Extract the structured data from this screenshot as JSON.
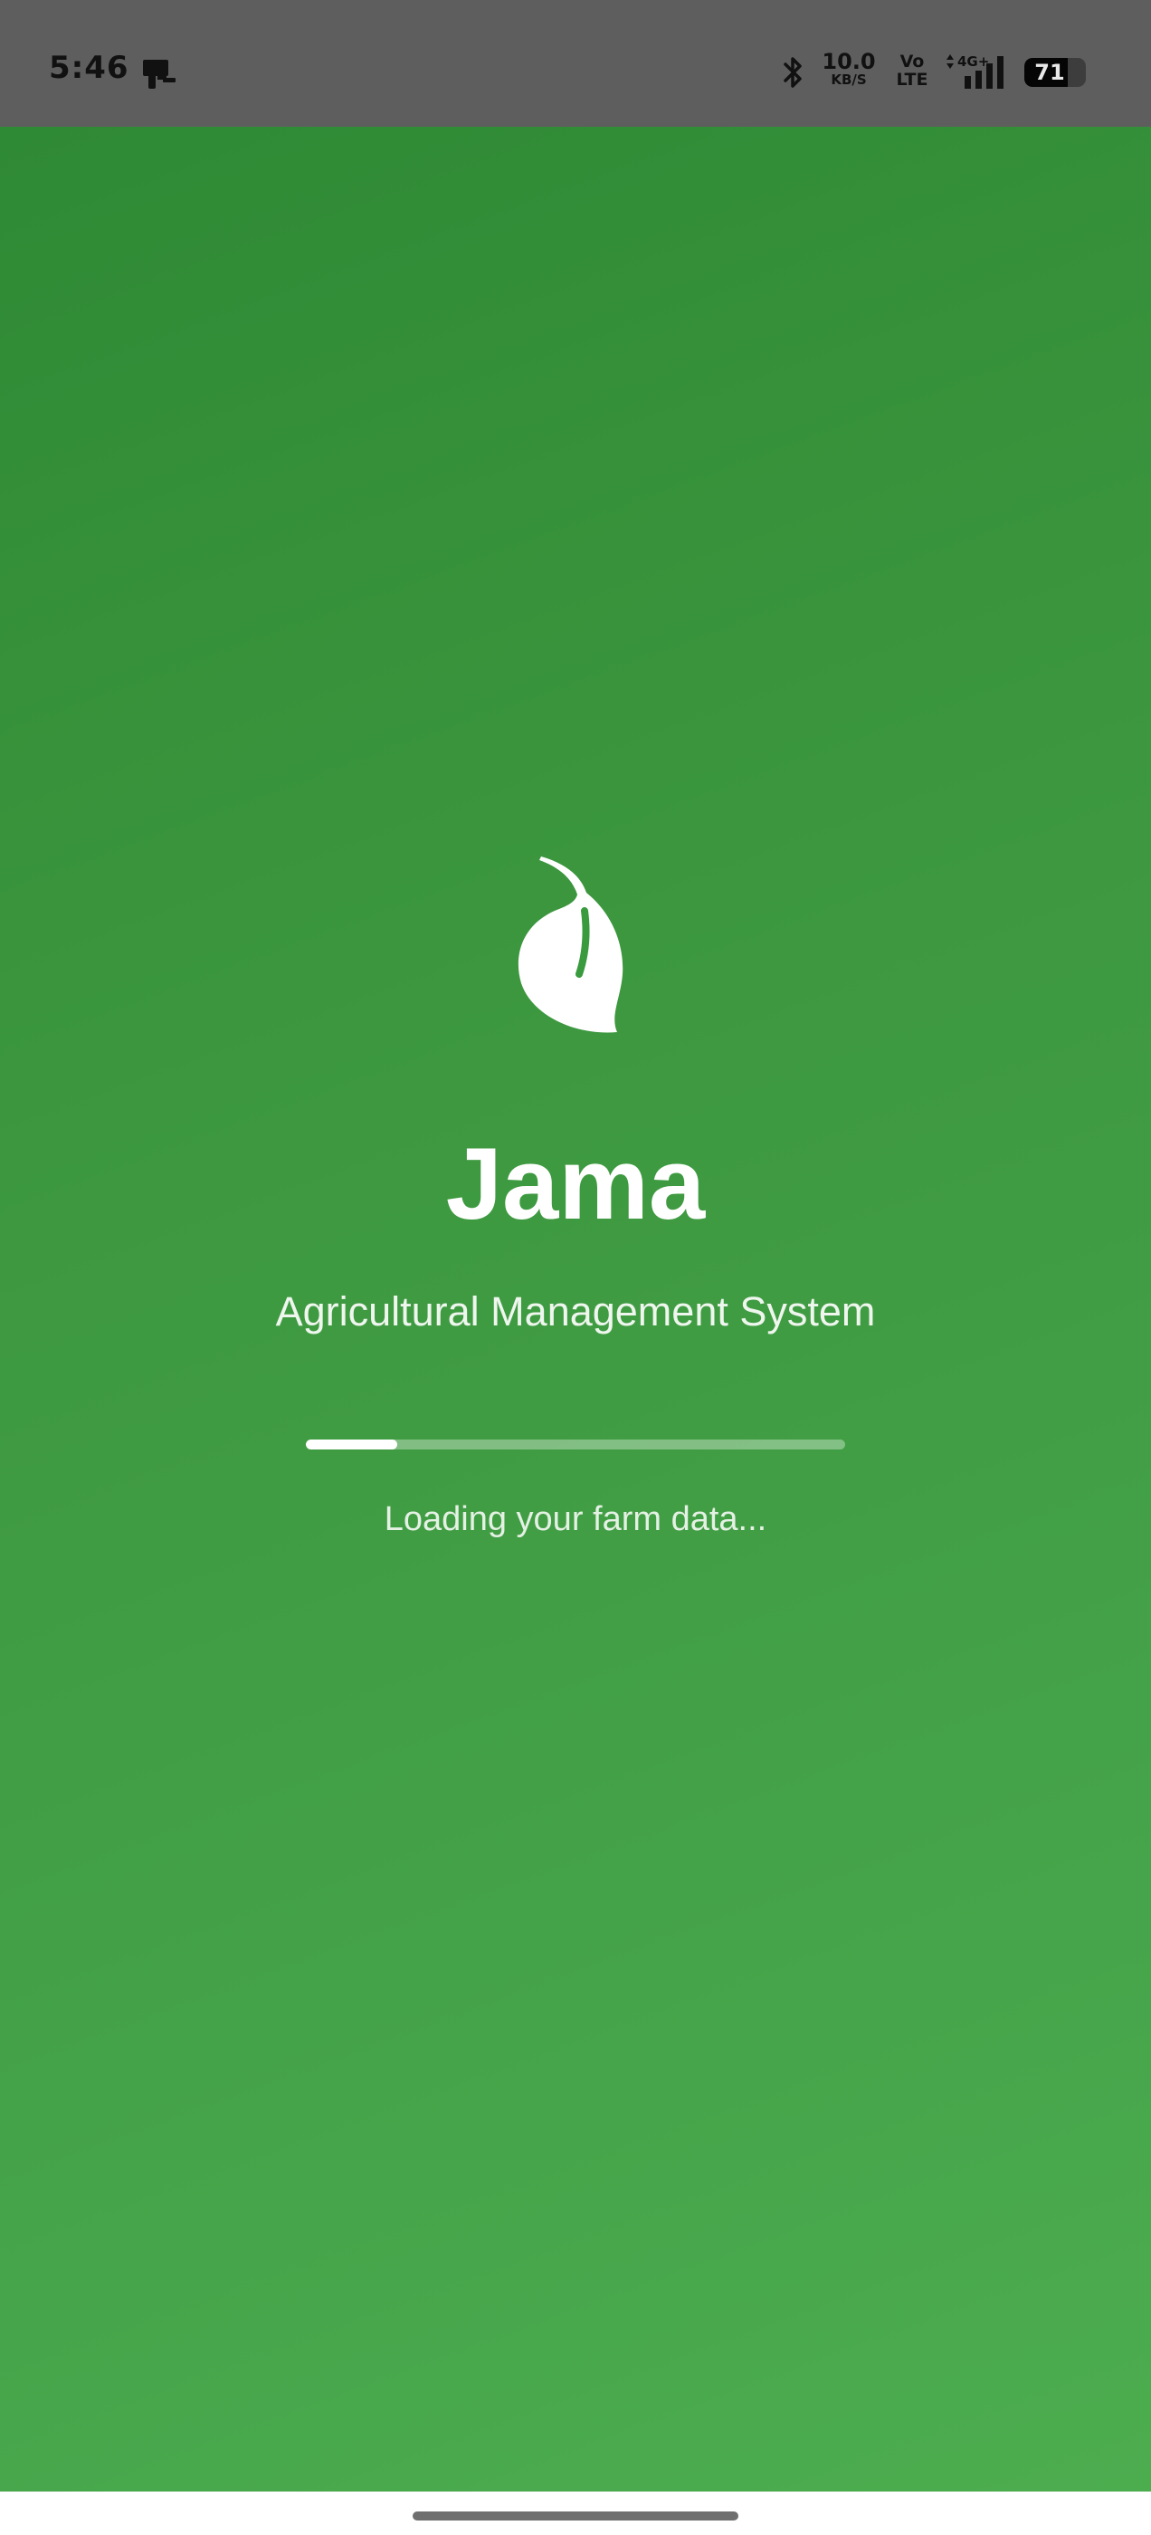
{
  "status_bar": {
    "time": "5:46",
    "notification_icon": "terminal-device-icon",
    "bluetooth_icon": "bluetooth-icon",
    "net_speed_value": "10.0",
    "net_speed_unit": "KB/S",
    "volte_top": "Vo",
    "volte_bottom": "LTE",
    "network_type": "4G+",
    "signal_icon": "cellular-signal-icon",
    "battery_level": "71",
    "battery_fraction": 0.71
  },
  "splash": {
    "logo_icon": "leaf-icon",
    "title": "Jama",
    "subtitle": "Agricultural Management System",
    "progress_fraction": 0.17,
    "loading_text": "Loading your farm data..."
  },
  "colors": {
    "gradient_start": "#2f8a35",
    "gradient_end": "#4cad4f",
    "status_bar_bg": "#5e5e5e",
    "text": "#ffffff"
  }
}
